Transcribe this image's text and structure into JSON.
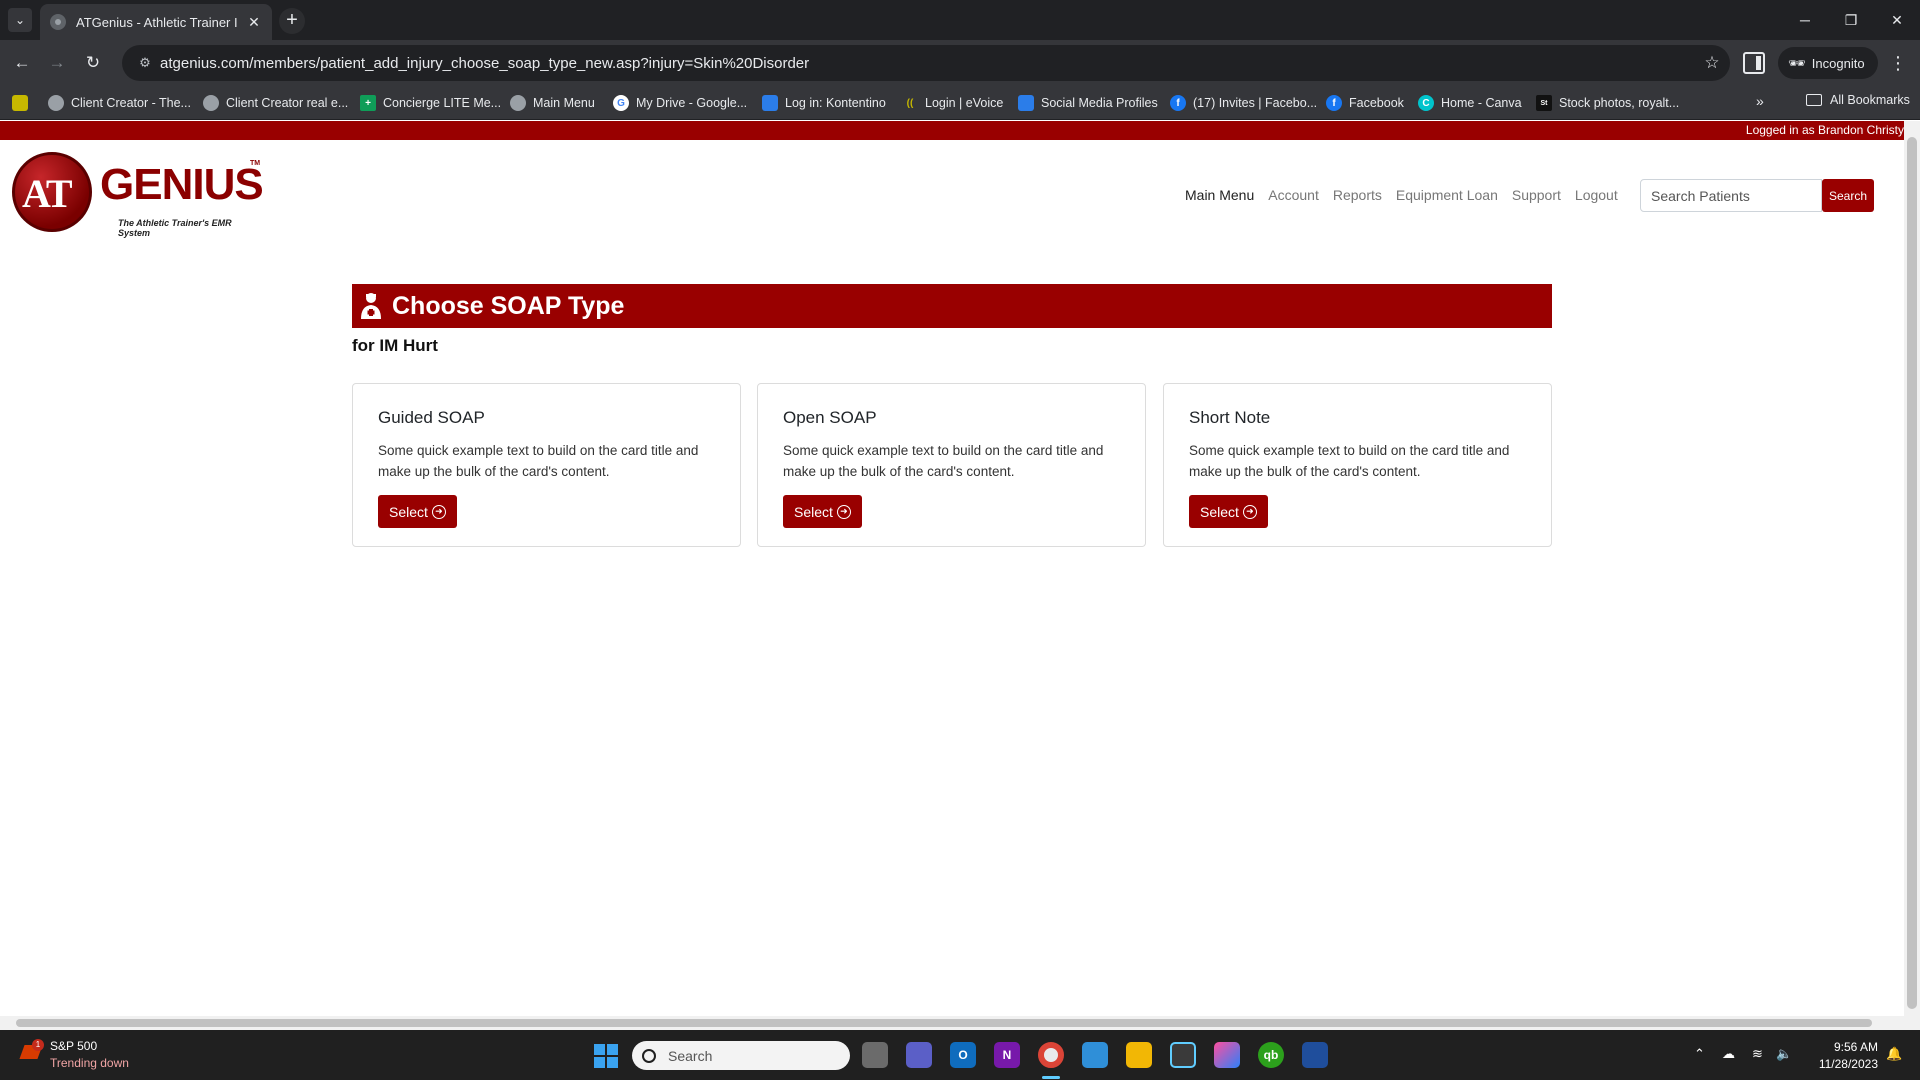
{
  "browser": {
    "tab_title": "ATGenius - Athletic Trainer Inju",
    "url": "atgenius.com/members/patient_add_injury_choose_soap_type_new.asp?injury=Skin%20Disorder",
    "incognito_label": "Incognito",
    "bookmarks": [
      {
        "label": "Client Creator - The...",
        "icon_color": "#9aa0a6"
      },
      {
        "label": "Client Creator real e...",
        "icon_color": "#9aa0a6"
      },
      {
        "label": "Concierge LITE Me...",
        "icon_color": "#0f9d58"
      },
      {
        "label": "Main Menu",
        "icon_color": "#9aa0a6"
      },
      {
        "label": "My Drive - Google...",
        "icon_color": "#4285f4"
      },
      {
        "label": "Log in: Kontentino",
        "icon_color": "#2b7de9"
      },
      {
        "label": "Login | eVoice",
        "icon_color": "#c6b800"
      },
      {
        "label": "Social Media Profiles",
        "icon_color": "#2b7de9"
      },
      {
        "label": "(17) Invites | Facebo...",
        "icon_color": "#1877f2"
      },
      {
        "label": "Facebook",
        "icon_color": "#1877f2"
      },
      {
        "label": "Home - Canva",
        "icon_color": "#00c4cc"
      },
      {
        "label": "Stock photos, royalt...",
        "icon_color": "#111111"
      }
    ],
    "all_bookmarks_label": "All Bookmarks"
  },
  "page": {
    "logged_in_text": "Logged in as Brandon Christy",
    "logo": {
      "at": "AT",
      "genius": "GENIUS",
      "tm": "TM",
      "tagline": "The Athletic Trainer's EMR System"
    },
    "nav": [
      {
        "label": "Main Menu",
        "active": true
      },
      {
        "label": "Account",
        "active": false
      },
      {
        "label": "Reports",
        "active": false
      },
      {
        "label": "Equipment Loan",
        "active": false
      },
      {
        "label": "Support",
        "active": false
      },
      {
        "label": "Logout",
        "active": false
      }
    ],
    "search": {
      "placeholder": "Search Patients",
      "button_label": "Search"
    },
    "heading": "Choose SOAP Type",
    "subheading": "for IM Hurt",
    "cards": [
      {
        "title": "Guided SOAP",
        "text": "Some quick example text to build on the card title and make up the bulk of the card's content.",
        "button": "Select"
      },
      {
        "title": "Open SOAP",
        "text": "Some quick example text to build on the card title and make up the bulk of the card's content.",
        "button": "Select"
      },
      {
        "title": "Short Note",
        "text": "Some quick example text to build on the card title and make up the bulk of the card's content.",
        "button": "Select"
      }
    ],
    "accent_color": "#990000"
  },
  "taskbar": {
    "widget": {
      "title": "S&P 500",
      "subtitle": "Trending down",
      "badge": "1"
    },
    "search_label": "Search",
    "time": "9:56 AM",
    "date": "11/28/2023"
  }
}
